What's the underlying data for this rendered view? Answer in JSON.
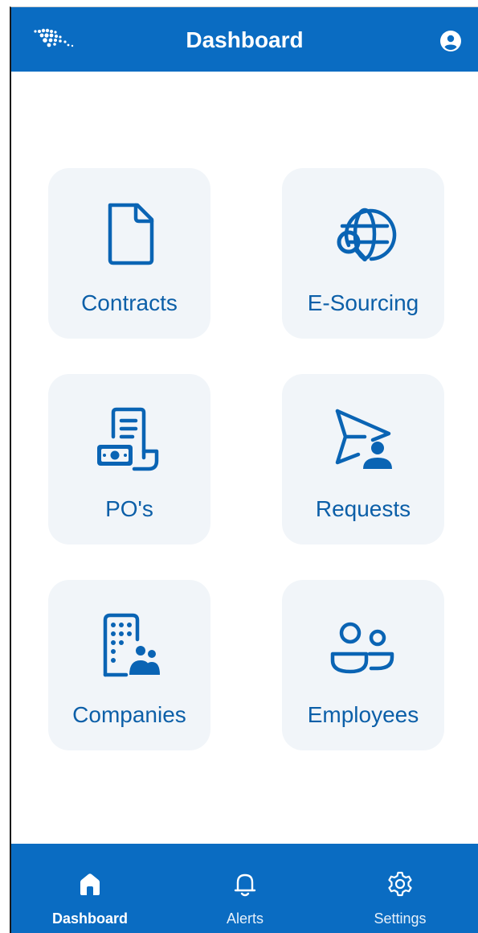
{
  "header": {
    "title": "Dashboard",
    "logo_icon": "brand-logo-icon",
    "profile_icon": "user-circle-icon"
  },
  "tiles": [
    {
      "label": "Contracts",
      "icon": "document-icon"
    },
    {
      "label": "E-Sourcing",
      "icon": "globe-search-icon"
    },
    {
      "label": "PO's",
      "icon": "purchase-order-cash-icon"
    },
    {
      "label": "Requests",
      "icon": "send-person-icon"
    },
    {
      "label": "Companies",
      "icon": "building-people-icon"
    },
    {
      "label": "Employees",
      "icon": "people-icon"
    }
  ],
  "tab_bar": {
    "active_tab": "Dashboard",
    "tabs": [
      {
        "label": "Dashboard",
        "icon": "home-icon"
      },
      {
        "label": "Alerts",
        "icon": "bell-icon"
      },
      {
        "label": "Settings",
        "icon": "gear-icon"
      }
    ]
  },
  "colors": {
    "primary": "#0a6cc2",
    "tile_background": "#f1f5f9",
    "tile_text": "#0c5fa8",
    "icon": "#0a64b4"
  }
}
